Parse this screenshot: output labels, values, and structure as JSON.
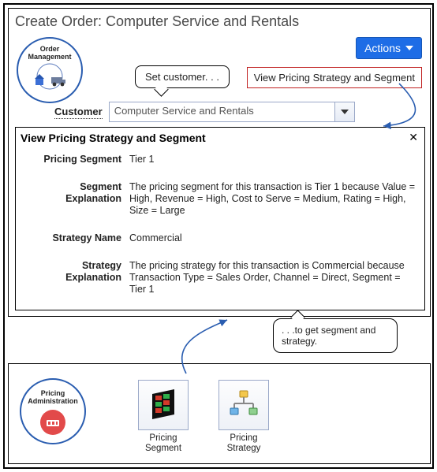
{
  "page_title": "Create Order: Computer Service and Rentals",
  "badges": {
    "order_mgmt_line1": "Order",
    "order_mgmt_line2": "Management",
    "pricing_admin_line1": "Pricing",
    "pricing_admin_line2": "Administration"
  },
  "actions": {
    "label": "Actions"
  },
  "callouts": {
    "set_customer": "Set customer. . .",
    "get_segment_strategy": ". . .to get segment and strategy."
  },
  "menu_item_view_strategy": "View Pricing Strategy and Segment",
  "customer": {
    "label": "Customer",
    "value": "Computer Service and Rentals"
  },
  "dialog": {
    "title": "View Pricing Strategy and Segment",
    "close": "✕",
    "rows": {
      "pricing_segment_label": "Pricing Segment",
      "pricing_segment_value": "Tier 1",
      "segment_explanation_label": "Segment Explanation",
      "segment_explanation_value": "The pricing segment for this transaction is Tier 1 because Value = High, Revenue = High, Cost to Serve = Medium, Rating = High, Size = Large",
      "strategy_name_label": "Strategy Name",
      "strategy_name_value": "Commercial",
      "strategy_explanation_label": "Strategy Explanation",
      "strategy_explanation_value": "The pricing strategy for this transaction is Commercial because Transaction Type = Sales Order, Channel = Direct, Segment = Tier 1"
    }
  },
  "tiles": {
    "pricing_segment_line1": "Pricing",
    "pricing_segment_line2": "Segment",
    "pricing_strategy_line1": "Pricing",
    "pricing_strategy_line2": "Strategy"
  }
}
